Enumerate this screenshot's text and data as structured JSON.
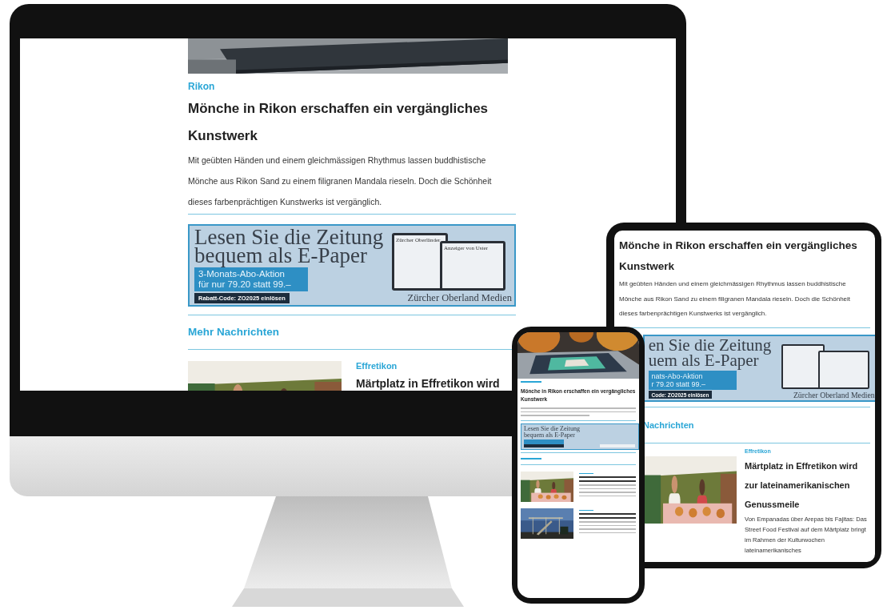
{
  "desktop": {
    "location": "Rikon",
    "title": "Mönche in Rikon erschaffen ein vergängliches Kunstwerk",
    "teaser": "Mit geübten Händen und einem gleichmässigen Rhythmus lassen buddhistische Mönche aus Rikon Sand zu einem filigranen Mandala rieseln. Doch die Schönheit dieses farbenprächtigen Kunstwerks ist vergänglich.",
    "ad": {
      "headline": [
        "Lesen Sie die Zeitung",
        "bequem als E-Paper"
      ],
      "offer": [
        "3-Monats-Abo-Aktion",
        "für nur 79.20 statt 99.–"
      ],
      "code": "Rabatt-Code: ZO2025 einlösen",
      "papers": [
        "Zürcher Oberländer",
        "Anzeiger von Uster"
      ],
      "brand": "Zürcher Oberland Medien"
    },
    "section": "Mehr Nachrichten",
    "articles": [
      {
        "kind": "teaser",
        "location": "Effretikon",
        "title": "Märtplatz in Effretikon wird"
      }
    ]
  },
  "tablet": {
    "title": "Mönche in Rikon erschaffen ein vergängliches Kunstwerk",
    "teaser": "Mit geübten Händen und einem gleichmässigen Rhythmus lassen buddhistische Mönche aus Rikon Sand zu einem filigranen Mandala rieseln. Doch die Schönheit dieses farbenprächtigen Kunstwerks ist vergänglich.",
    "ad": {
      "headline": [
        "en Sie die Zeitung",
        "uem als E-Paper"
      ],
      "offer": [
        "nats-Abo-Aktion",
        "r 79.20 statt 99.–"
      ],
      "code": "Code: ZO2025 einlösen",
      "brand": "Zürcher Oberland Medien"
    },
    "section": "Nachrichten",
    "articles": [
      {
        "kind": "teaser",
        "location": "Effretikon",
        "title": "Märtplatz in Effretikon wird zur lateinamerikanischen Genussmeile",
        "teaser": "Von Empanadas über Arepas bis Fajitas: Das Street Food Festival auf dem Märtplatz bringt im Rahmen der Kulturwochen lateinamerikanisches"
      }
    ]
  },
  "phone": {
    "title": "Mönche in Rikon erschaffen ein vergängliches Kunstwerk",
    "ad": {
      "headline": [
        "Lesen Sie die Zeitung",
        "bequem als E-Paper"
      ]
    }
  }
}
